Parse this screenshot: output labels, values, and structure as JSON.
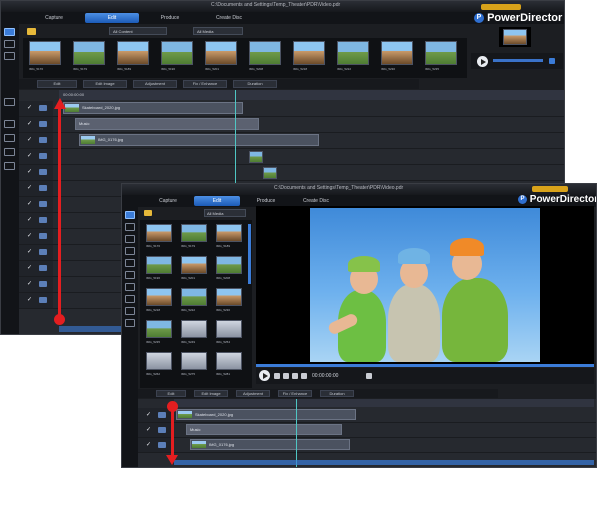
{
  "back_window": {
    "title_path": "C:\\Documents and Settings\\Temp_Theater\\PDR\\Video.pdr",
    "tabs": [
      "Capture",
      "Edit",
      "Produce",
      "Create Disc"
    ],
    "active_tab": "Edit",
    "brand": "PowerDirector",
    "upgrade_badge": "",
    "library_dropdowns": [
      "All Content",
      "All Media"
    ],
    "thumbnails": [
      "IMG_5176",
      "IMG_5179",
      "IMG_5189",
      "IMG_5196",
      "IMG_5201",
      "IMG_5208",
      "IMG_5218",
      "IMG_5222",
      "IMG_5230",
      "IMG_5235"
    ],
    "edit_toolbar": [
      "Edit",
      "Edit Image",
      "Adjustment",
      "Fix / Enhance",
      "Duration"
    ],
    "timeline_clips": [
      {
        "label": "Skateboard_2020.jpg",
        "track": 0
      },
      {
        "label": "Music",
        "track": 1
      },
      {
        "label": "IMG_0176.jpg",
        "track": 2
      }
    ],
    "ruler_time": "00:00:00:00"
  },
  "front_window": {
    "title_path": "C:\\Documents and Settings\\Temp_Theater\\PDR\\Video.pdr",
    "tabs": [
      "Capture",
      "Edit",
      "Produce",
      "Create Disc"
    ],
    "active_tab": "Edit",
    "brand": "PowerDirector",
    "library_dropdown": "All Media",
    "library_items": [
      "IMG_5176",
      "IMG_5179",
      "IMG_5189",
      "IMG_5196",
      "IMG_5201",
      "IMG_5208",
      "IMG_5218",
      "IMG_5222",
      "IMG_5230",
      "IMG_5235",
      "IMG_5249",
      "IMG_5254",
      "IMG_5262",
      "IMG_5275",
      "IMG_5281"
    ],
    "edit_toolbar": [
      "Edit",
      "Edit Image",
      "Adjustment",
      "Fix / Enhance",
      "Duration"
    ],
    "timeline_clips": [
      {
        "label": "Skateboard_2020.jpg",
        "track": 0
      },
      {
        "label": "Music",
        "track": 1
      },
      {
        "label": "IMG_0176.jpg",
        "track": 2
      }
    ],
    "preview_timecode": "00:00:00:00"
  },
  "colors": {
    "accent": "#1c5bb8",
    "playhead": "#4fc6c4",
    "annotation_arrow": "#e41e20",
    "window_bg": "#1c1e22"
  },
  "icons": [
    "folder-icon",
    "play-icon",
    "stop-icon",
    "check-icon",
    "film-icon",
    "powerdirector-logo-icon"
  ]
}
